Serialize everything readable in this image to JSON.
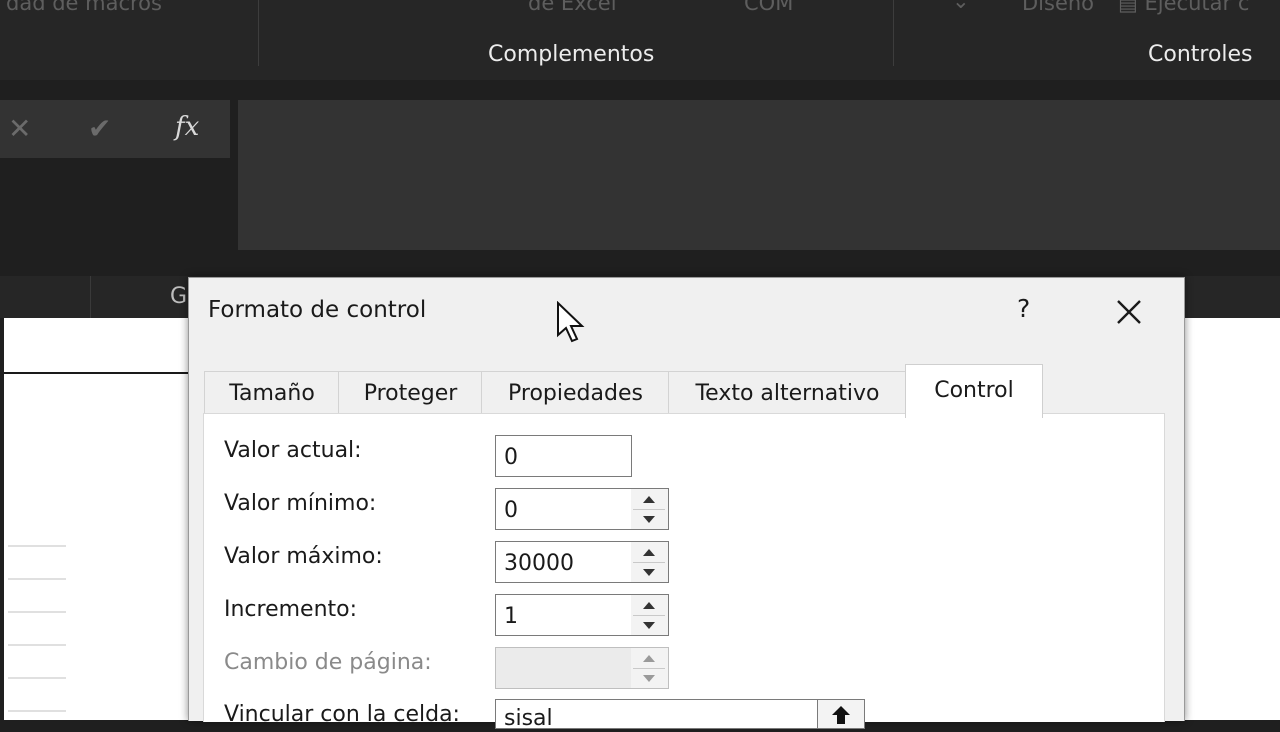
{
  "ribbon": {
    "fragments": [
      "dad de macros",
      "de Excel",
      "COM",
      "Diseño",
      "Ejecutar c"
    ],
    "groups": [
      "Complementos",
      "Controles"
    ]
  },
  "formula_bar": {
    "cancel_icon": "x-icon",
    "enter_icon": "check-icon",
    "function_label": "fx",
    "value": ""
  },
  "column_headers": [
    "G"
  ],
  "dialog": {
    "title": "Formato de control",
    "help": "?",
    "tabs": [
      {
        "label": "Tamaño",
        "active": false
      },
      {
        "label": "Proteger",
        "active": false
      },
      {
        "label": "Propiedades",
        "active": false
      },
      {
        "label": "Texto alternativo",
        "active": false
      },
      {
        "label": "Control",
        "active": true
      }
    ],
    "fields": [
      {
        "label": "Valor actual:",
        "value": "0"
      },
      {
        "label": "Valor mínimo:",
        "value": "0"
      },
      {
        "label": "Valor máximo:",
        "value": "30000"
      },
      {
        "label": "Incremento:",
        "value": "1"
      },
      {
        "label": "Cambio de página:",
        "value": "",
        "disabled": true
      },
      {
        "label": "Vincular con la celda:",
        "value": "sisal"
      }
    ]
  },
  "colors": {
    "ribbon_bg": "#262626",
    "dialog_bg": "#f0f0f0",
    "panel_bg": "#ffffff"
  }
}
